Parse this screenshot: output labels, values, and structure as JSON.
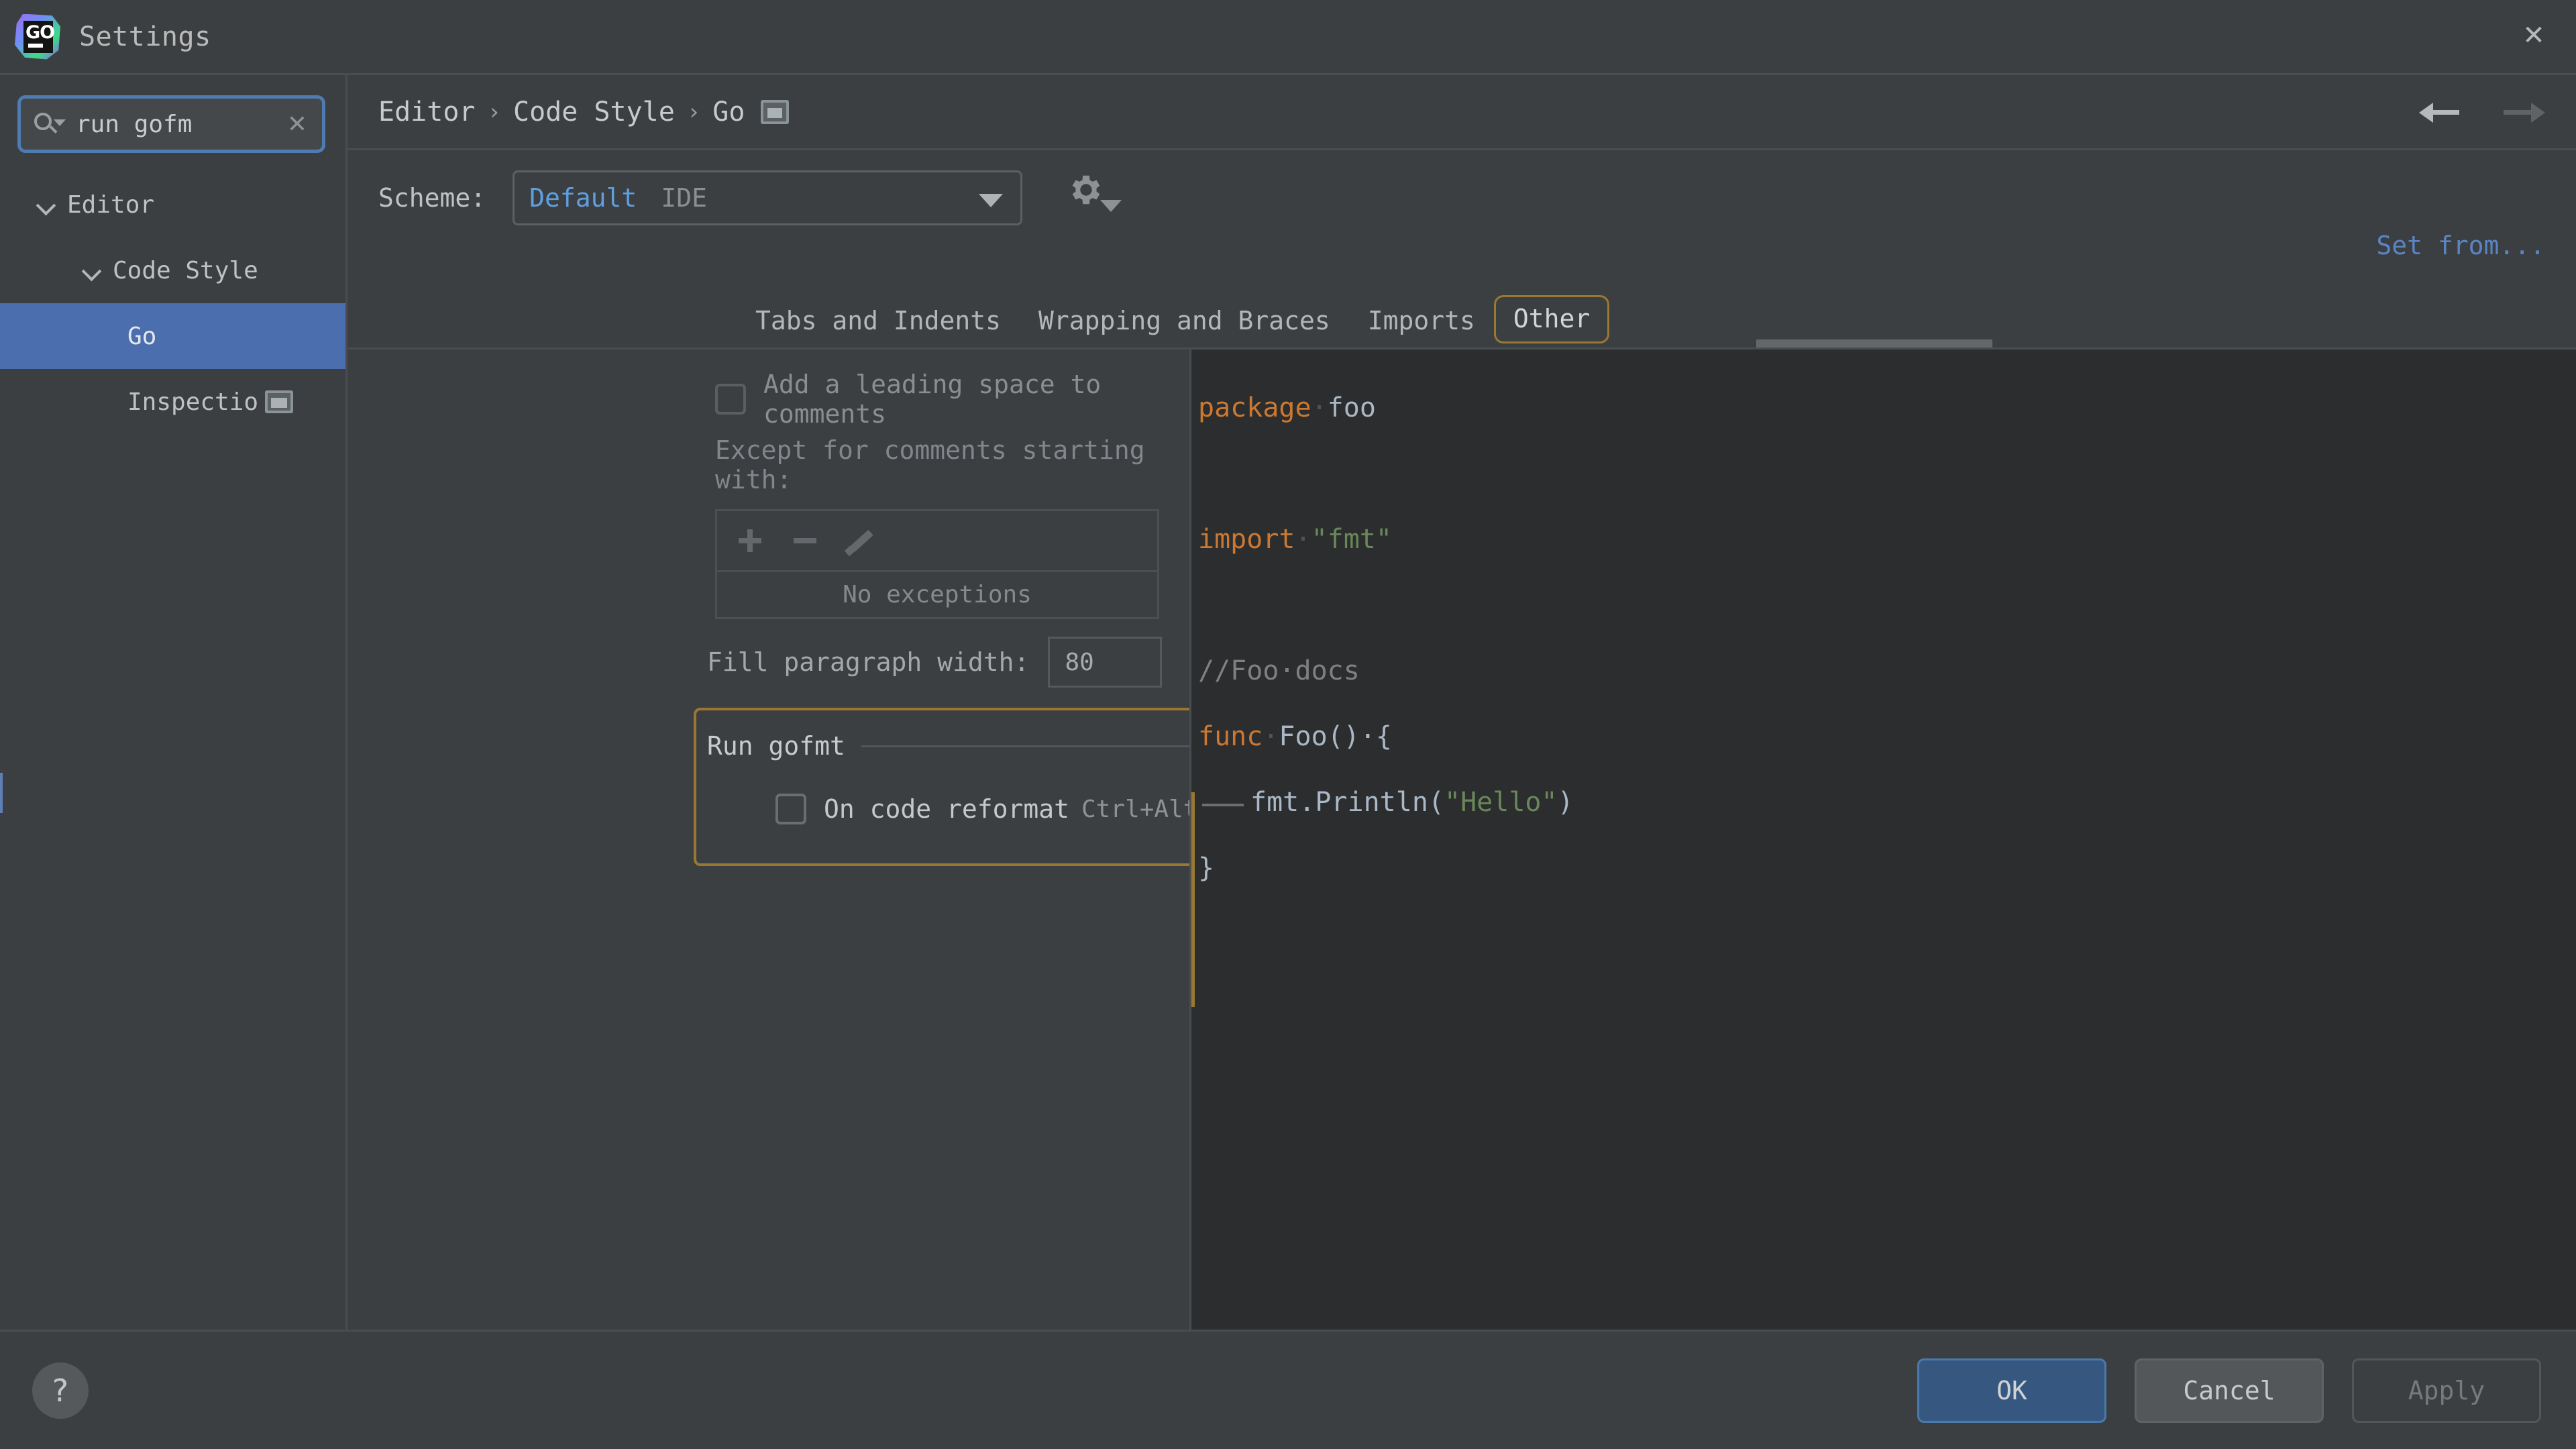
{
  "window": {
    "title": "Settings",
    "logo_text": "GO",
    "close_icon": "close-icon"
  },
  "search": {
    "value": "run gofm",
    "clear_label": "✕",
    "icon": "search-icon"
  },
  "sidebar": {
    "items": [
      {
        "label": "Editor",
        "level": 1,
        "expandable": true,
        "selected": false,
        "truncated": false
      },
      {
        "label": "Code Style",
        "level": 2,
        "expandable": true,
        "selected": false,
        "truncated": false
      },
      {
        "label": "Go",
        "level": 3,
        "expandable": false,
        "selected": true,
        "truncated": false
      },
      {
        "label": "Inspectio",
        "level": 3,
        "expandable": false,
        "selected": false,
        "truncated": true
      }
    ]
  },
  "breadcrumb": {
    "items": [
      "Editor",
      "Code Style",
      "Go"
    ],
    "separator": "›",
    "icon": "panel-window-icon"
  },
  "nav": {
    "back_icon": "arrow-left-icon",
    "forward_icon": "arrow-right-icon"
  },
  "scheme": {
    "label": "Scheme:",
    "value": "Default",
    "scope": "IDE",
    "dropdown_icon": "chevron-down-icon",
    "gear_icon": "gear-icon"
  },
  "actions": {
    "set_from": "Set from..."
  },
  "tabs": [
    {
      "label": "Tabs and Indents",
      "active": false
    },
    {
      "label": "Wrapping and Braces",
      "active": false
    },
    {
      "label": "Imports",
      "active": false
    },
    {
      "label": "Other",
      "active": true
    }
  ],
  "settings": {
    "leading_space": {
      "label": "Add a leading space to comments",
      "checked": false,
      "enabled": false
    },
    "exceptions": {
      "label": "Except for comments starting with:",
      "empty_text": "No exceptions",
      "toolbar": [
        {
          "icon": "plus-icon",
          "name": "add-exception-button"
        },
        {
          "icon": "minus-icon",
          "name": "remove-exception-button"
        },
        {
          "icon": "pencil-icon",
          "name": "edit-exception-button"
        }
      ]
    },
    "fill_paragraph": {
      "label": "Fill paragraph width:",
      "value": "80"
    },
    "run_gofmt": {
      "title": "Run gofmt",
      "highlighted": true,
      "option": {
        "label": "On code reformat",
        "shortcut": "Ctrl+Alt+L",
        "checked": false
      }
    }
  },
  "preview": {
    "lines": [
      {
        "tokens": [
          {
            "t": "package",
            "c": "kw"
          },
          {
            "t": "·",
            "c": "ws"
          },
          {
            "t": "foo",
            "c": "ident"
          }
        ]
      },
      {
        "tokens": []
      },
      {
        "tokens": [
          {
            "t": "import",
            "c": "kw"
          },
          {
            "t": "·",
            "c": "ws"
          },
          {
            "t": "\"fmt\"",
            "c": "str"
          }
        ]
      },
      {
        "tokens": []
      },
      {
        "tokens": [
          {
            "t": "//Foo·docs",
            "c": "cmt"
          }
        ]
      },
      {
        "tokens": [
          {
            "t": "func",
            "c": "kw"
          },
          {
            "t": "·",
            "c": "ws"
          },
          {
            "t": "Foo()·{",
            "c": "ident"
          }
        ]
      },
      {
        "indent": true,
        "tokens": [
          {
            "t": "fmt.Println(",
            "c": "ident"
          },
          {
            "t": "\"Hello\"",
            "c": "str"
          },
          {
            "t": ")",
            "c": "ident"
          }
        ]
      },
      {
        "tokens": [
          {
            "t": "}",
            "c": "ident"
          }
        ]
      }
    ]
  },
  "footer": {
    "help_label": "?",
    "buttons": [
      {
        "label": "OK",
        "style": "primary"
      },
      {
        "label": "Cancel",
        "style": "normal"
      },
      {
        "label": "Apply",
        "style": "disabled"
      }
    ]
  },
  "colors": {
    "accent_blue": "#4b6eaf",
    "link_blue": "#5a84c4",
    "highlight_orange": "#9a7832",
    "keyword_orange": "#cc7832",
    "string_green": "#6a8759",
    "comment_gray": "#808080",
    "panel_bg": "#3c3f41",
    "editor_bg": "#2b2d2e"
  }
}
